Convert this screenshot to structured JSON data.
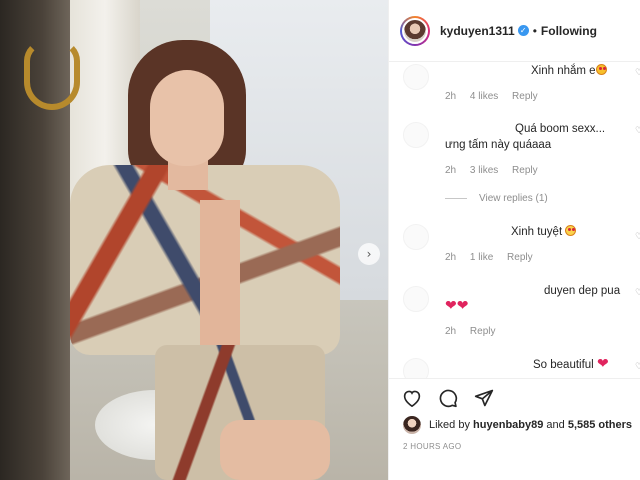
{
  "post": {
    "username": "kyduyen1311",
    "follow_status": "Following",
    "separator": "•"
  },
  "photo": {
    "next_arrow": "›"
  },
  "comments": [
    {
      "text": "Xinh nhắm e",
      "time": "2h",
      "likes": "4 likes",
      "reply": "Reply"
    },
    {
      "text_line1": "Quá boom sexx...",
      "text_line2": "ưng tấm này quáaaa",
      "time": "2h",
      "likes": "3 likes",
      "reply": "Reply"
    },
    {
      "view_replies": "View replies (1)"
    },
    {
      "text": "Xinh tuyệt",
      "time": "2h",
      "likes": "1 like",
      "reply": "Reply"
    },
    {
      "text": "duyen dep pua",
      "time": "2h",
      "reply": "Reply"
    },
    {
      "text": "So beautiful"
    }
  ],
  "likes": {
    "prefix": "Liked by",
    "user": "huyenbaby89",
    "connector": "and",
    "others": "5,585 others"
  },
  "time_ago": "2 HOURS AGO",
  "icons": [
    "heart-icon",
    "comment-icon",
    "share-icon"
  ]
}
